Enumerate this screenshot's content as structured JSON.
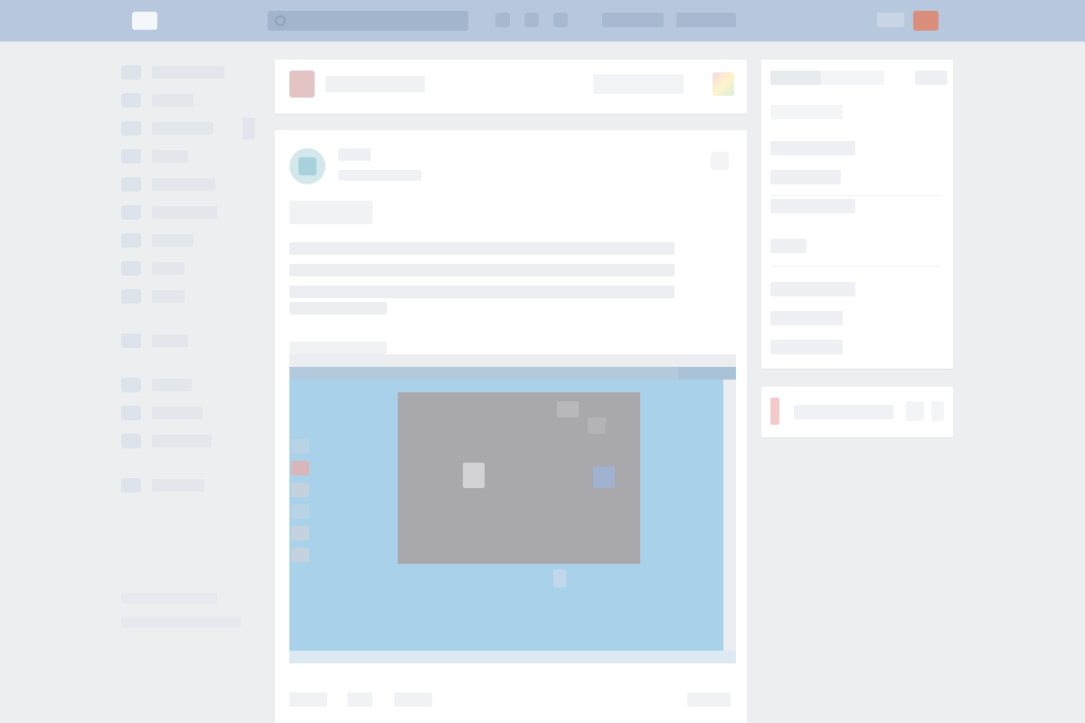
{
  "colors": {
    "header": "#b7c8de",
    "page_background": "#edeef0",
    "card_background": "#ffffff",
    "desktop_sky": "#a9d2ea",
    "window_gray": "#a9a8ad",
    "avatar_accent": "#d98f7b"
  },
  "header": {
    "logo_icon": "vk-logo-icon",
    "search_placeholder": "",
    "icons": [
      "bell-icon",
      "music-icon",
      "play-icon"
    ],
    "links": [
      "",
      ""
    ]
  },
  "sidebar": {
    "items": [
      {
        "label": "",
        "icon": "user-icon"
      },
      {
        "label": "",
        "icon": "news-icon"
      },
      {
        "label": "",
        "icon": "messages-icon"
      },
      {
        "label": "",
        "icon": "friends-icon"
      },
      {
        "label": "",
        "icon": "communities-icon"
      },
      {
        "label": "",
        "icon": "photos-icon"
      },
      {
        "label": "",
        "icon": "music-icon"
      },
      {
        "label": "",
        "icon": "video-icon"
      },
      {
        "label": "",
        "icon": "games-icon"
      }
    ],
    "items_b": [
      {
        "label": "",
        "icon": "apps-icon"
      }
    ],
    "items_c": [
      {
        "label": "",
        "icon": "bookmarks-icon"
      },
      {
        "label": "",
        "icon": "market-icon"
      },
      {
        "label": "",
        "icon": "ads-icon"
      }
    ],
    "items_d": [
      {
        "label": "",
        "icon": "more-icon"
      }
    ],
    "footer": [
      "",
      ""
    ]
  },
  "compose": {
    "placeholder": ""
  },
  "post": {
    "author": "",
    "date": "",
    "title": "",
    "caption": "",
    "actions": [
      "",
      "",
      ""
    ],
    "views": ""
  },
  "right_panel": {
    "header_a": "",
    "header_b": "",
    "rows": [
      "",
      "",
      "",
      "",
      "",
      "",
      "",
      ""
    ]
  },
  "promo": {
    "text": ""
  }
}
